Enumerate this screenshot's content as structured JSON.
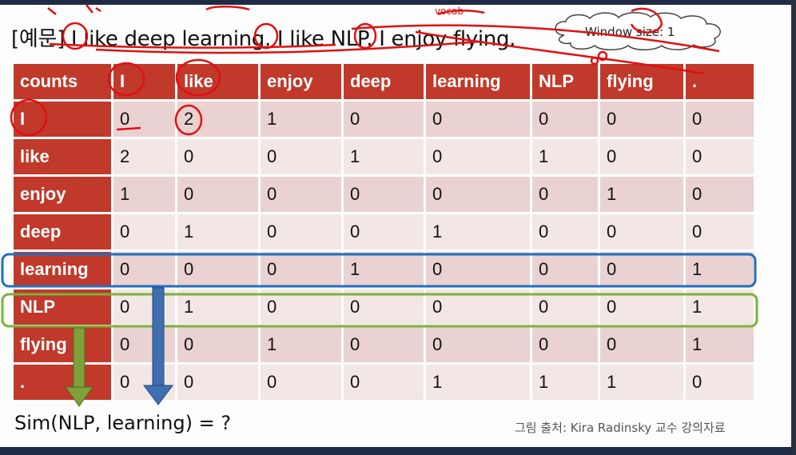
{
  "slide": {
    "example_sentence": "[예문] I like deep learning. I like NLP. I enjoy flying.",
    "window_size_label": "Window size: 1",
    "similarity_question": "Sim(NLP, learning) = ?",
    "source_credit": "그림 출처: Kira Radinsky 교수 강의자료"
  },
  "matrix": {
    "corner_label": "counts",
    "columns": [
      "I",
      "like",
      "enjoy",
      "deep",
      "learning",
      "NLP",
      "flying",
      "."
    ],
    "rows": [
      {
        "label": "I",
        "values": [
          0,
          2,
          1,
          0,
          0,
          0,
          0,
          0
        ]
      },
      {
        "label": "like",
        "values": [
          2,
          0,
          0,
          1,
          0,
          1,
          0,
          0
        ]
      },
      {
        "label": "enjoy",
        "values": [
          1,
          0,
          0,
          0,
          0,
          0,
          1,
          0
        ]
      },
      {
        "label": "deep",
        "values": [
          0,
          1,
          0,
          0,
          1,
          0,
          0,
          0
        ]
      },
      {
        "label": "learning",
        "values": [
          0,
          0,
          0,
          1,
          0,
          0,
          0,
          1
        ]
      },
      {
        "label": "NLP",
        "values": [
          0,
          1,
          0,
          0,
          0,
          0,
          0,
          1
        ]
      },
      {
        "label": "flying",
        "values": [
          0,
          0,
          1,
          0,
          0,
          0,
          0,
          1
        ]
      },
      {
        "label": ".",
        "values": [
          0,
          0,
          0,
          0,
          1,
          1,
          1,
          0
        ]
      }
    ]
  },
  "colors": {
    "header_red": "#c0392b",
    "row_shade_a": "#e9d2d1",
    "row_shade_b": "#f3e7e6",
    "ink_red": "#e01010",
    "highlight_blue": "#1f6fbf",
    "highlight_green": "#7bb23a"
  },
  "annotations": {
    "handwritten_note_vocab": "vocab"
  }
}
